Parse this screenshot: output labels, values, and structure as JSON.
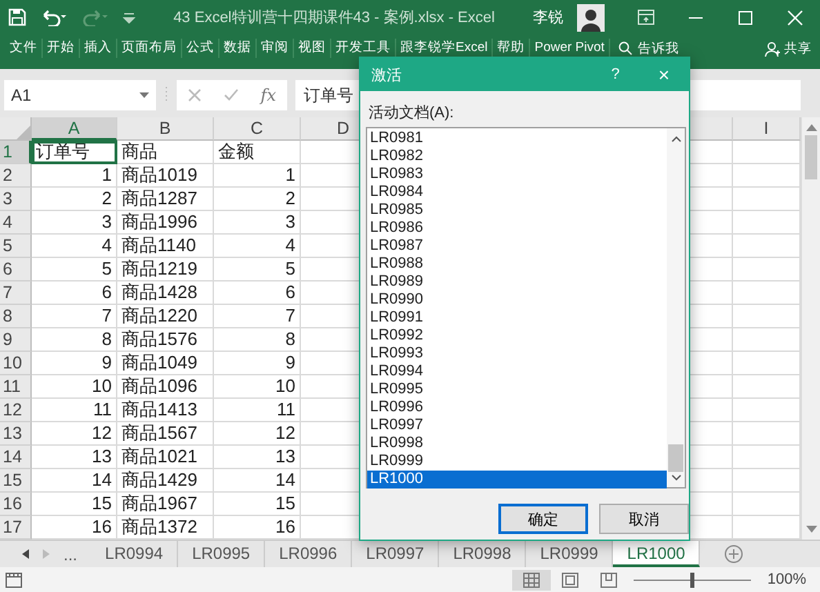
{
  "title_bar": {
    "title": "43 Excel特训营十四期课件43 - 案例.xlsx  -  Excel",
    "user": "李锐"
  },
  "ribbon": {
    "tabs": [
      {
        "label": "文件",
        "selected": false
      },
      {
        "label": "开始",
        "selected": false
      },
      {
        "label": "插入",
        "selected": false
      },
      {
        "label": "页面布局",
        "selected": false
      },
      {
        "label": "公式",
        "selected": false
      },
      {
        "label": "数据",
        "selected": false
      },
      {
        "label": "审阅",
        "selected": false
      },
      {
        "label": "视图",
        "selected": false
      },
      {
        "label": "开发工具",
        "selected": false
      },
      {
        "label": "跟李锐学Excel",
        "selected": false
      },
      {
        "label": "帮助",
        "selected": false
      },
      {
        "label": "Power Pivot",
        "selected": false
      }
    ],
    "tell_me": "告诉我",
    "share": "共享"
  },
  "formula_bar": {
    "name_box": "A1",
    "function_label": "fx",
    "content": "订单号"
  },
  "sheet": {
    "columns": [
      {
        "label": "A",
        "selected": true,
        "numeric": true
      },
      {
        "label": "B",
        "selected": false,
        "numeric": false
      },
      {
        "label": "C",
        "selected": false,
        "numeric": true
      },
      {
        "label": "D",
        "selected": false
      },
      {
        "label": "I",
        "selected": false
      }
    ],
    "rows": [
      {
        "number": "1",
        "selected": true,
        "kind": "labels",
        "cells": [
          "订单号",
          "商品",
          "金额"
        ]
      },
      {
        "number": "2",
        "selected": false,
        "kind": "values",
        "cells": [
          "1",
          "商品1019",
          "1"
        ]
      },
      {
        "number": "3",
        "selected": false,
        "kind": "values",
        "cells": [
          "2",
          "商品1287",
          "2"
        ]
      },
      {
        "number": "4",
        "selected": false,
        "kind": "values",
        "cells": [
          "3",
          "商品1996",
          "3"
        ]
      },
      {
        "number": "5",
        "selected": false,
        "kind": "values",
        "cells": [
          "4",
          "商品1140",
          "4"
        ]
      },
      {
        "number": "6",
        "selected": false,
        "kind": "values",
        "cells": [
          "5",
          "商品1219",
          "5"
        ]
      },
      {
        "number": "7",
        "selected": false,
        "kind": "values",
        "cells": [
          "6",
          "商品1428",
          "6"
        ]
      },
      {
        "number": "8",
        "selected": false,
        "kind": "values",
        "cells": [
          "7",
          "商品1220",
          "7"
        ]
      },
      {
        "number": "9",
        "selected": false,
        "kind": "values",
        "cells": [
          "8",
          "商品1576",
          "8"
        ]
      },
      {
        "number": "10",
        "selected": false,
        "kind": "values",
        "cells": [
          "9",
          "商品1049",
          "9"
        ]
      },
      {
        "number": "11",
        "selected": false,
        "kind": "values",
        "cells": [
          "10",
          "商品1096",
          "10"
        ]
      },
      {
        "number": "12",
        "selected": false,
        "kind": "values",
        "cells": [
          "11",
          "商品1413",
          "11"
        ]
      },
      {
        "number": "13",
        "selected": false,
        "kind": "values",
        "cells": [
          "12",
          "商品1567",
          "12"
        ]
      },
      {
        "number": "14",
        "selected": false,
        "kind": "values",
        "cells": [
          "13",
          "商品1021",
          "13"
        ]
      },
      {
        "number": "15",
        "selected": false,
        "kind": "values",
        "cells": [
          "14",
          "商品1429",
          "14"
        ]
      },
      {
        "number": "16",
        "selected": false,
        "kind": "values",
        "cells": [
          "15",
          "商品1967",
          "15"
        ]
      },
      {
        "number": "17",
        "selected": false,
        "kind": "values",
        "cells": [
          "16",
          "商品1372",
          "16"
        ]
      }
    ]
  },
  "sheet_tabs": {
    "more": "...",
    "tabs": [
      {
        "label": "LR0994",
        "selected": false
      },
      {
        "label": "LR0995",
        "selected": false
      },
      {
        "label": "LR0996",
        "selected": false
      },
      {
        "label": "LR0997",
        "selected": false
      },
      {
        "label": "LR0998",
        "selected": false
      },
      {
        "label": "LR0999",
        "selected": false
      },
      {
        "label": "LR1000",
        "selected": true
      }
    ]
  },
  "status_bar": {
    "zoom": {
      "level": 0.5
    },
    "zoom_text": "100%"
  },
  "dialog": {
    "title": "激活",
    "help": "?",
    "close": "×",
    "label": "活动文档(A):",
    "items": [
      {
        "label": "LR0981",
        "selected": false
      },
      {
        "label": "LR0982",
        "selected": false
      },
      {
        "label": "LR0983",
        "selected": false
      },
      {
        "label": "LR0984",
        "selected": false
      },
      {
        "label": "LR0985",
        "selected": false
      },
      {
        "label": "LR0986",
        "selected": false
      },
      {
        "label": "LR0987",
        "selected": false
      },
      {
        "label": "LR0988",
        "selected": false
      },
      {
        "label": "LR0989",
        "selected": false
      },
      {
        "label": "LR0990",
        "selected": false
      },
      {
        "label": "LR0991",
        "selected": false
      },
      {
        "label": "LR0992",
        "selected": false
      },
      {
        "label": "LR0993",
        "selected": false
      },
      {
        "label": "LR0994",
        "selected": false
      },
      {
        "label": "LR0995",
        "selected": false
      },
      {
        "label": "LR0996",
        "selected": false
      },
      {
        "label": "LR0997",
        "selected": false
      },
      {
        "label": "LR0998",
        "selected": false
      },
      {
        "label": "LR0999",
        "selected": false
      },
      {
        "label": "LR1000",
        "selected": true
      }
    ],
    "buttons": [
      {
        "label": "确定",
        "default": true
      },
      {
        "label": "取消",
        "default": false
      }
    ]
  }
}
